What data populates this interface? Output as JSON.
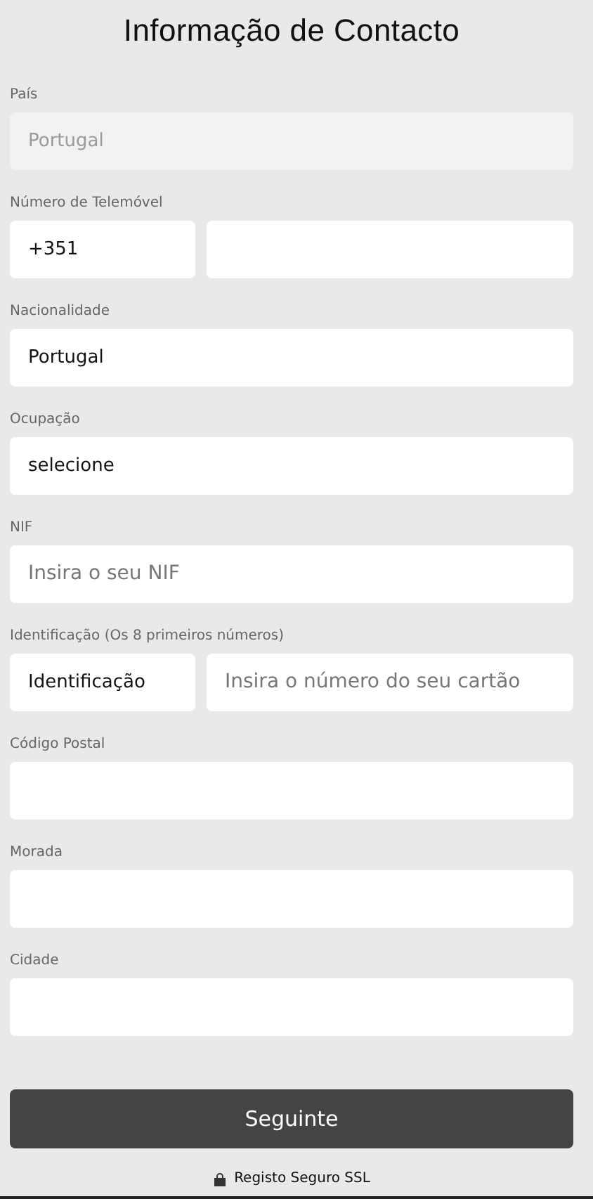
{
  "title": "Informação de Contacto",
  "fields": [
    {
      "label": "País",
      "inputs": [
        {
          "value": "Portugal",
          "disabled": true
        }
      ]
    },
    {
      "label": "Número de Telemóvel",
      "inputs": [
        {
          "value": "+351",
          "disabled": false
        },
        {
          "disabled": false
        }
      ]
    },
    {
      "label": "Nacionalidade",
      "inputs": [
        {
          "value": "Portugal",
          "disabled": false
        }
      ]
    },
    {
      "label": "Ocupação",
      "inputs": [
        {
          "value": "selecione",
          "disabled": false
        }
      ]
    },
    {
      "label": "NIF",
      "inputs": [
        {
          "placeholder": "Insira o seu NIF",
          "disabled": false
        }
      ]
    },
    {
      "label": "Identificação (Os 8 primeiros números)",
      "inputs": [
        {
          "value": "Identificação",
          "disabled": false
        },
        {
          "placeholder": "Insira o número do seu cartão",
          "disabled": false
        }
      ]
    },
    {
      "label": "Código Postal",
      "inputs": [
        {
          "disabled": false
        }
      ]
    },
    {
      "label": "Morada",
      "inputs": [
        {
          "disabled": false
        }
      ]
    },
    {
      "label": "Cidade",
      "inputs": [
        {
          "disabled": false
        }
      ]
    }
  ],
  "submit": "Seguinte",
  "secure_note": "Registo Seguro SSL"
}
